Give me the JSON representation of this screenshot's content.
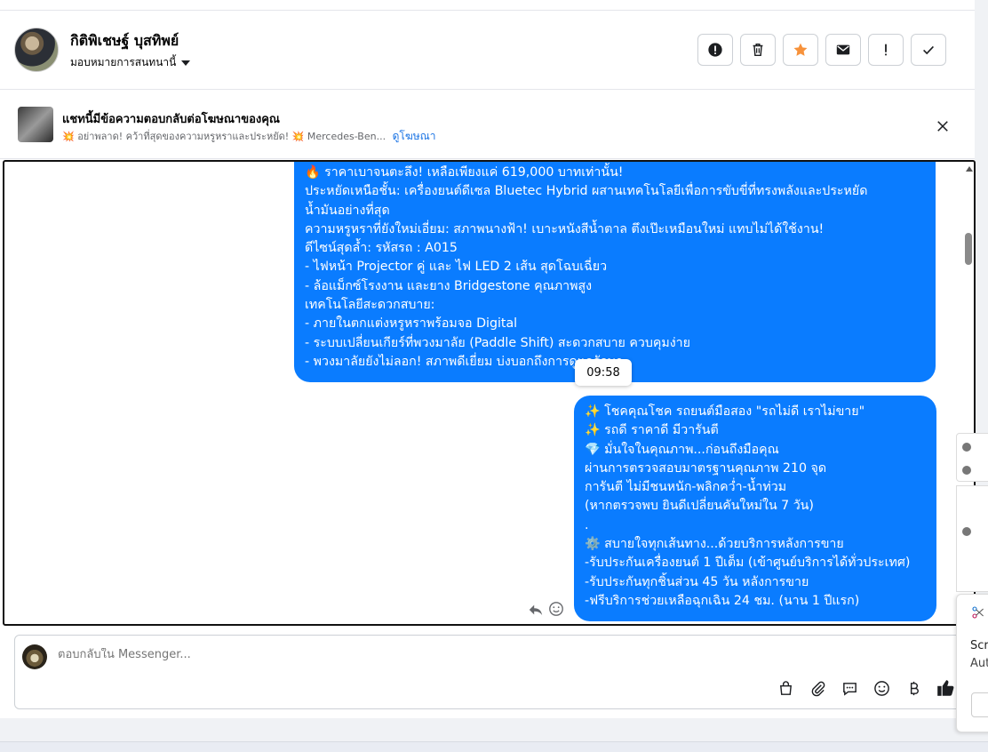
{
  "header": {
    "user_name": "กิติพิเชษฐ์ บุสทิพย์",
    "assign_label": "มอบหมายการสนทนานี้",
    "actions": [
      {
        "icon": "exclamation-circle-icon"
      },
      {
        "icon": "trash-icon"
      },
      {
        "icon": "star-icon"
      },
      {
        "icon": "envelope-icon"
      },
      {
        "icon": "exclamation-icon"
      },
      {
        "icon": "check-icon"
      }
    ]
  },
  "ad": {
    "title": "แชทนี้มีข้อความตอบกลับต่อโฆษณาของคุณ",
    "subtitle": "💥 อย่าพลาด! คว้าที่สุดของความหรูหราและประหยัด! 💥 Mercedes-Ben...",
    "link": "ดูโฆษณา"
  },
  "messages": [
    {
      "text": "🔥 ราคาเบาจนตะลึง! เหลือเพียงแค่ 619,000 บาทเท่านั้น!\nประหยัดเหนือชั้น: เครื่องยนต์ดีเซล Bluetec Hybrid ผสานเทคโนโลยีเพื่อการขับขี่ที่ทรงพลังและประหยัด\nน้ำมันอย่างที่สุด\nความหรูหราที่ยังใหม่เอี่ยม: สภาพนางฟ้า! เบาะหนังสีน้ำตาล ตึงเป๊ะเหมือนใหม่ แทบไม่ได้ใช้งาน!\nดีไซน์สุดล้ำ: รหัสรถ : A015\n- ไฟหน้า Projector คู่ และ ไฟ LED 2 เส้น สุดโฉบเฉี่ยว\n- ล้อแม็กซ์โรงงาน และยาง Bridgestone คุณภาพสูง\nเทคโนโลยีสะดวกสบาย:\n- ภายในตกแต่งหรูหราพร้อมจอ Digital\n- ระบบเปลี่ยนเกียร์ที่พวงมาลัย (Paddle Shift) สะดวกสบาย ควบคุมง่าย\n- พวงมาลัยยังไม่ลอก! สภาพดีเยี่ยม บ่งบอกถึงการดูแลรักษา"
    },
    {
      "text": "✨ โชคคุณโชค รถยนต์มือสอง \"รถไม่ดี เราไม่ขาย\"\n✨ รถดี ราคาดี มีวารันตี\n💎 มั่นใจในคุณภาพ...ก่อนถึงมือคุณ\nผ่านการตรวจสอบมาตรฐานคุณภาพ 210 จุด\nการันตี ไม่มีชนหนัก-พลิกคว่ำ-น้ำท่วม\n(หากตรวจพบ ยินดีเปลี่ยนคันใหม่ใน 7 วัน)\n.\n⚙️ สบายใจทุกเส้นทาง...ด้วยบริการหลังการขาย\n-รับประกันเครื่องยนต์ 1 ปีเต็ม (เข้าศูนย์บริการได้ทั่วประเทศ)\n-รับประกันทุกชิ้นส่วน 45 วัน หลังการขาย\n-ฟรีบริการช่วยเหลือฉุกเฉิน 24 ชม. (นาน 1 ปีแรก)"
    }
  ],
  "time_chip": "09:58",
  "composer": {
    "placeholder": "ตอบกลับใน Messenger...",
    "tools": [
      "bag-icon",
      "paperclip-icon",
      "speech-bubble-icon",
      "smiley-icon",
      "baht-icon",
      "thumbs-up-icon"
    ]
  },
  "side_panel": {
    "text_1": "Scre",
    "text_2": "Aut"
  },
  "colors": {
    "bubble": "#0a7cff",
    "link": "#1b74e4",
    "star": "#f7923b"
  }
}
